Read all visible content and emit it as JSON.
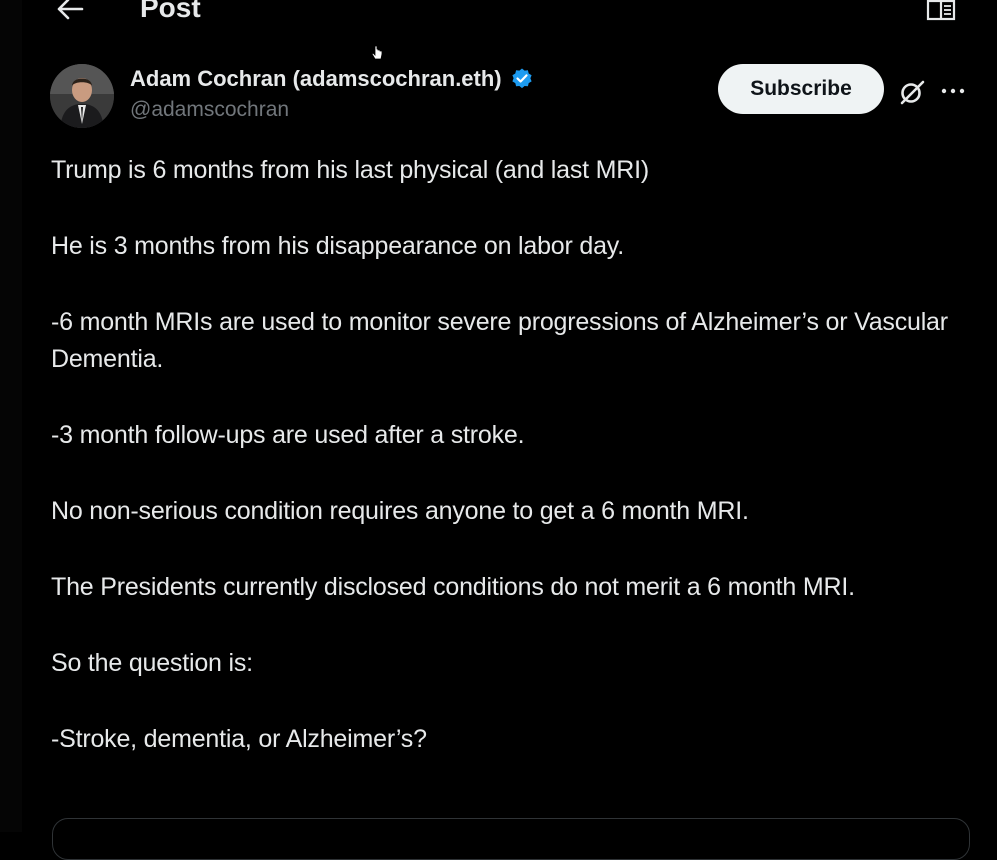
{
  "header": {
    "back_icon": "arrow-left-icon",
    "title": "Post",
    "reader_icon": "reader-mode-icon"
  },
  "author": {
    "display_name": "Adam Cochran (adamscochran.eth)",
    "handle": "@adamscochran",
    "verified_icon": "verified-badge-icon",
    "verified_color": "#1d9bf0"
  },
  "actions": {
    "subscribe_label": "Subscribe",
    "grok_icon": "grok-icon",
    "more_icon": "more-dots-icon"
  },
  "post": {
    "paragraphs": [
      "Trump is 6 months from his last physical (and last MRI)",
      "He is 3 months from his disappearance on labor day.",
      "-6 month MRIs are used to monitor severe progressions of Alzheimer’s or Vascular Dementia.",
      "-3 month follow-ups are used after a stroke.",
      "No non-serious condition requires anyone to get a 6 month MRI.",
      "The Presidents currently disclosed conditions do not merit a 6 month MRI.",
      "So the question is:",
      "-Stroke, dementia, or Alzheimer’s?"
    ]
  },
  "colors": {
    "background": "#000000",
    "text_primary": "#e7e9ea",
    "text_secondary": "#71767b",
    "button_bg": "#eff3f4",
    "button_text": "#0f1419"
  }
}
